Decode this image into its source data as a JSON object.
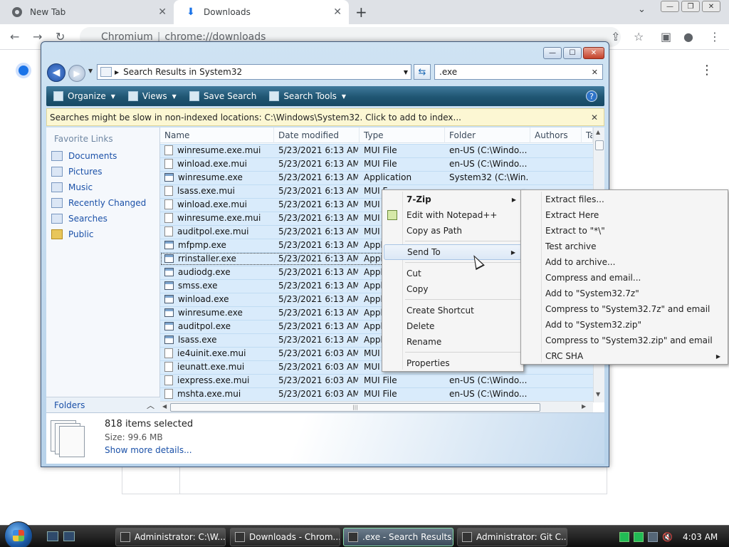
{
  "browser": {
    "tabs": [
      {
        "title": "New Tab",
        "active": false
      },
      {
        "title": "Downloads",
        "active": true
      }
    ],
    "url_host": "Chromium",
    "url_path": "chrome://downloads"
  },
  "explorer": {
    "address": "Search Results in System32",
    "search_query": ".exe",
    "toolbar": {
      "organize": "Organize",
      "views": "Views",
      "save_search": "Save Search",
      "search_tools": "Search Tools"
    },
    "info_bar": "Searches might be slow in non-indexed locations: C:\\Windows\\System32. Click to add to index...",
    "nav": {
      "heading": "Favorite Links",
      "items": [
        "Documents",
        "Pictures",
        "Music",
        "Recently Changed",
        "Searches",
        "Public"
      ],
      "folders_label": "Folders"
    },
    "columns": [
      "Name",
      "Date modified",
      "Type",
      "Folder",
      "Authors",
      "Ta"
    ],
    "rows": [
      {
        "name": "winresume.exe.mui",
        "date": "5/23/2021 6:13 AM",
        "type": "MUI File",
        "folder": "en-US (C:\\Windo...",
        "icon": "file"
      },
      {
        "name": "winload.exe.mui",
        "date": "5/23/2021 6:13 AM",
        "type": "MUI File",
        "folder": "en-US (C:\\Windo...",
        "icon": "file"
      },
      {
        "name": "winresume.exe",
        "date": "5/23/2021 6:13 AM",
        "type": "Application",
        "folder": "System32 (C:\\Win...",
        "icon": "app"
      },
      {
        "name": "lsass.exe.mui",
        "date": "5/23/2021 6:13 AM",
        "type": "MUI F",
        "folder": "",
        "icon": "file"
      },
      {
        "name": "winload.exe.mui",
        "date": "5/23/2021 6:13 AM",
        "type": "MUI",
        "folder": "",
        "icon": "file"
      },
      {
        "name": "winresume.exe.mui",
        "date": "5/23/2021 6:13 AM",
        "type": "MUI",
        "folder": "",
        "icon": "file"
      },
      {
        "name": "auditpol.exe.mui",
        "date": "5/23/2021 6:13 AM",
        "type": "MUI",
        "folder": "",
        "icon": "file"
      },
      {
        "name": "mfpmp.exe",
        "date": "5/23/2021 6:13 AM",
        "type": "Appl",
        "folder": "",
        "icon": "app"
      },
      {
        "name": "rrinstaller.exe",
        "date": "5/23/2021 6:13 AM",
        "type": "Appl",
        "folder": "",
        "icon": "app",
        "focus": true
      },
      {
        "name": "audiodg.exe",
        "date": "5/23/2021 6:13 AM",
        "type": "Appl",
        "folder": "",
        "icon": "app"
      },
      {
        "name": "smss.exe",
        "date": "5/23/2021 6:13 AM",
        "type": "Appl",
        "folder": "",
        "icon": "app"
      },
      {
        "name": "winload.exe",
        "date": "5/23/2021 6:13 AM",
        "type": "Appl",
        "folder": "",
        "icon": "app"
      },
      {
        "name": "winresume.exe",
        "date": "5/23/2021 6:13 AM",
        "type": "Appl",
        "folder": "",
        "icon": "app"
      },
      {
        "name": "auditpol.exe",
        "date": "5/23/2021 6:13 AM",
        "type": "Appl",
        "folder": "",
        "icon": "app"
      },
      {
        "name": "lsass.exe",
        "date": "5/23/2021 6:13 AM",
        "type": "Appl",
        "folder": "",
        "icon": "app"
      },
      {
        "name": "ie4uinit.exe.mui",
        "date": "5/23/2021 6:03 AM",
        "type": "MUI",
        "folder": "",
        "icon": "file"
      },
      {
        "name": "ieunatt.exe.mui",
        "date": "5/23/2021 6:03 AM",
        "type": "MUI",
        "folder": "",
        "icon": "file"
      },
      {
        "name": "iexpress.exe.mui",
        "date": "5/23/2021 6:03 AM",
        "type": "MUI File",
        "folder": "en-US (C:\\Windo...",
        "icon": "file"
      },
      {
        "name": "mshta.exe.mui",
        "date": "5/23/2021 6:03 AM",
        "type": "MUI File",
        "folder": "en-US (C:\\Windo...",
        "icon": "file"
      }
    ],
    "details": {
      "count": "818 items selected",
      "size": "Size: 99.6 MB",
      "more": "Show more details..."
    }
  },
  "context_menu": {
    "items": [
      {
        "label": "7-Zip",
        "bold": true,
        "submenu": true
      },
      {
        "label": "Edit with Notepad++",
        "icon": true
      },
      {
        "label": "Copy as Path"
      },
      {
        "sep": true
      },
      {
        "label": "Send To",
        "submenu": true,
        "hover": true
      },
      {
        "sep": true
      },
      {
        "label": "Cut"
      },
      {
        "label": "Copy"
      },
      {
        "sep": true
      },
      {
        "label": "Create Shortcut"
      },
      {
        "label": "Delete"
      },
      {
        "label": "Rename"
      },
      {
        "sep": true
      },
      {
        "label": "Properties"
      }
    ]
  },
  "submenu": {
    "items": [
      {
        "label": "Extract files..."
      },
      {
        "label": "Extract Here"
      },
      {
        "label": "Extract to \"*\\\""
      },
      {
        "label": "Test archive"
      },
      {
        "label": "Add to archive..."
      },
      {
        "label": "Compress and email..."
      },
      {
        "label": "Add to \"System32.7z\""
      },
      {
        "label": "Compress to \"System32.7z\" and email"
      },
      {
        "label": "Add to \"System32.zip\""
      },
      {
        "label": "Compress to \"System32.zip\" and email"
      },
      {
        "label": "CRC SHA",
        "submenu": true
      }
    ]
  },
  "taskbar": {
    "tasks": [
      {
        "label": "Administrator: C:\\W...",
        "active": false
      },
      {
        "label": "Downloads - Chrom...",
        "active": false
      },
      {
        "label": ".exe - Search Results...",
        "active": true
      },
      {
        "label": "Administrator: Git C...",
        "active": false
      }
    ],
    "clock": "4:03 AM"
  }
}
